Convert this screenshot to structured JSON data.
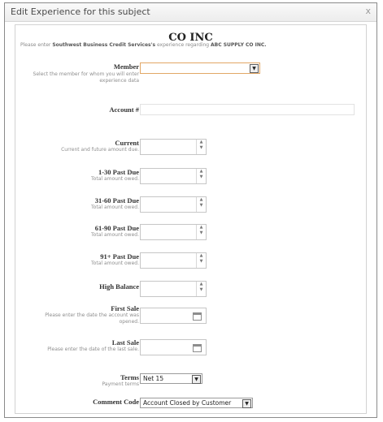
{
  "dialog": {
    "title": "Edit Experience for this subject",
    "close_label": "x"
  },
  "company": {
    "name": "CO INC"
  },
  "intro": {
    "prefix": "Please enter",
    "provider": "Southwest Business Credit Services's",
    "middle": "experience regarding",
    "subject": "ABC SUPPLY CO INC."
  },
  "fields": {
    "member": {
      "label": "Member",
      "hint": "Select the member for whom you will enter experience data",
      "value": ""
    },
    "account": {
      "label": "Account #",
      "value": ""
    },
    "current": {
      "label": "Current",
      "hint": "Current and future amount due."
    },
    "past_due_1_30": {
      "label": "1-30 Past Due",
      "hint": "Total amount owed."
    },
    "past_due_31_60": {
      "label": "31-60 Past Due",
      "hint": "Total amount owed."
    },
    "past_due_61_90": {
      "label": "61-90 Past Due",
      "hint": "Total amount owed."
    },
    "past_due_91_plus": {
      "label": "91+ Past Due",
      "hint": "Total amount owed."
    },
    "high_balance": {
      "label": "High Balance"
    },
    "first_sale": {
      "label": "First Sale",
      "hint": "Please enter the date the account was opened."
    },
    "last_sale": {
      "label": "Last Sale",
      "hint": "Please enter the date of the last sale."
    },
    "terms": {
      "label": "Terms",
      "hint": "Payment terms",
      "value": "Net 15"
    },
    "comment_code": {
      "label": "Comment Code",
      "value": "Account Closed by Customer"
    }
  },
  "icons": {
    "spinner": "spinner-arrows-icon",
    "calendar": "calendar-icon",
    "dropdown": "dropdown-arrow-icon"
  }
}
